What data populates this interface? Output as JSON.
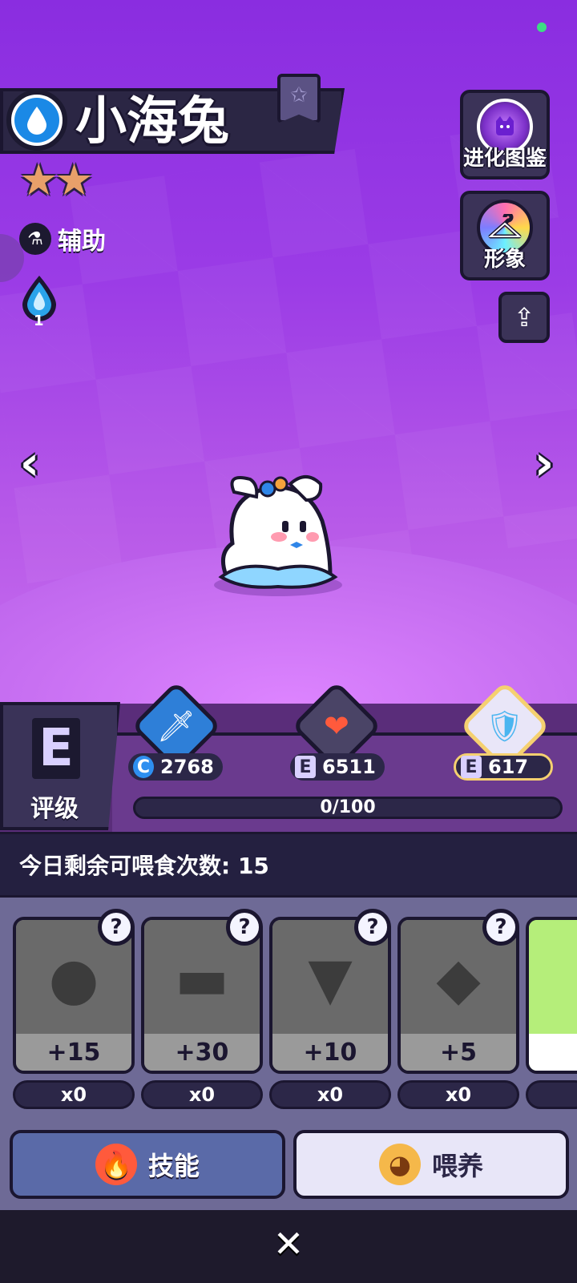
{
  "pet": {
    "name": "小海兔",
    "stars": 2,
    "role": "辅助",
    "element_level": "1"
  },
  "right_menu": {
    "evolution_label": "进化图鉴",
    "skin_label": "形象"
  },
  "grade": {
    "letter": "E",
    "label": "评级"
  },
  "stats": [
    {
      "rank": "C",
      "value": "2768",
      "icon": "sword-icon"
    },
    {
      "rank": "E",
      "value": "6511",
      "icon": "heart-icon"
    },
    {
      "rank": "E",
      "value": "617",
      "icon": "shield-icon",
      "selected": true
    }
  ],
  "progress": {
    "text": "0/100",
    "fraction": 0
  },
  "feeding": {
    "remaining_text": "今日剩余可喂食次数: 15"
  },
  "foods": [
    {
      "bonus": "+15",
      "qty": "x0",
      "unknown": "?"
    },
    {
      "bonus": "+30",
      "qty": "x0",
      "unknown": "?"
    },
    {
      "bonus": "+10",
      "qty": "x0",
      "unknown": "?"
    },
    {
      "bonus": "+5",
      "qty": "x0",
      "unknown": "?"
    }
  ],
  "actions": {
    "skill_label": "技能",
    "feed_label": "喂养"
  },
  "colors": {
    "background_purple": "#8a2de0",
    "accent_gold": "#f5d070",
    "panel_dark": "#242040"
  }
}
